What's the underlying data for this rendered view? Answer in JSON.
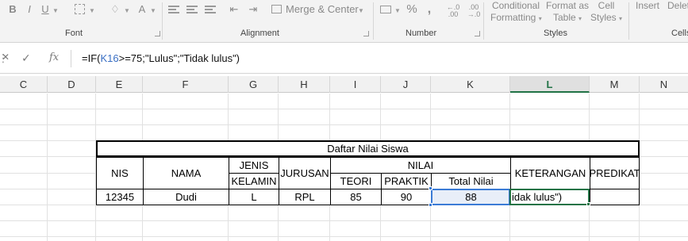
{
  "ribbon": {
    "font": {
      "label": "Font",
      "bold": "B",
      "italic": "I",
      "underline": "U",
      "font_color": "A"
    },
    "alignment": {
      "label": "Alignment",
      "merge_label": "Merge & Center"
    },
    "number": {
      "label": "Number",
      "percent": "%",
      "comma": ","
    },
    "styles": {
      "label": "Styles",
      "conditional_line1": "Conditional",
      "conditional_line2": "Formatting",
      "format_table_line1": "Format as",
      "format_table_line2": "Table",
      "cell_styles_line1": "Cell",
      "cell_styles_line2": "Styles"
    },
    "cells": {
      "label": "Cells",
      "insert": "Insert",
      "delete": "Delete"
    }
  },
  "formula_bar": {
    "cancel_icon": "close-icon",
    "enter_icon": "check-icon",
    "fx": "fx",
    "part1": "=IF(",
    "ref": "K16",
    "part2": ">=75;\"Lulus\";\"Tidak lulus\")"
  },
  "columns": [
    "C",
    "D",
    "E",
    "F",
    "G",
    "H",
    "I",
    "J",
    "K",
    "L",
    "M",
    "N"
  ],
  "active_column": "L",
  "table": {
    "title": "Daftar Nilai Siswa",
    "headers": {
      "nis": "NIS",
      "nama": "NAMA",
      "jenis": "JENIS",
      "kelamin": "KELAMIN",
      "jurusan": "JURUSAN",
      "nilai": "NILAI",
      "teori": "TEORI",
      "praktik": "PRAKTIK",
      "total": "Total Nilai",
      "keterangan": "KETERANGAN",
      "predikat": "PREDIKAT"
    },
    "row": {
      "nis": "12345",
      "nama": "Dudi",
      "jk": "L",
      "jurusan": "RPL",
      "teori": "85",
      "praktik": "90",
      "total": "88",
      "editing": "idak lulus\")",
      "predikat": ""
    }
  },
  "colors": {
    "excel_green": "#217346",
    "selection_blue": "#3b7bd6",
    "ref_blue": "#3a6fc4"
  }
}
